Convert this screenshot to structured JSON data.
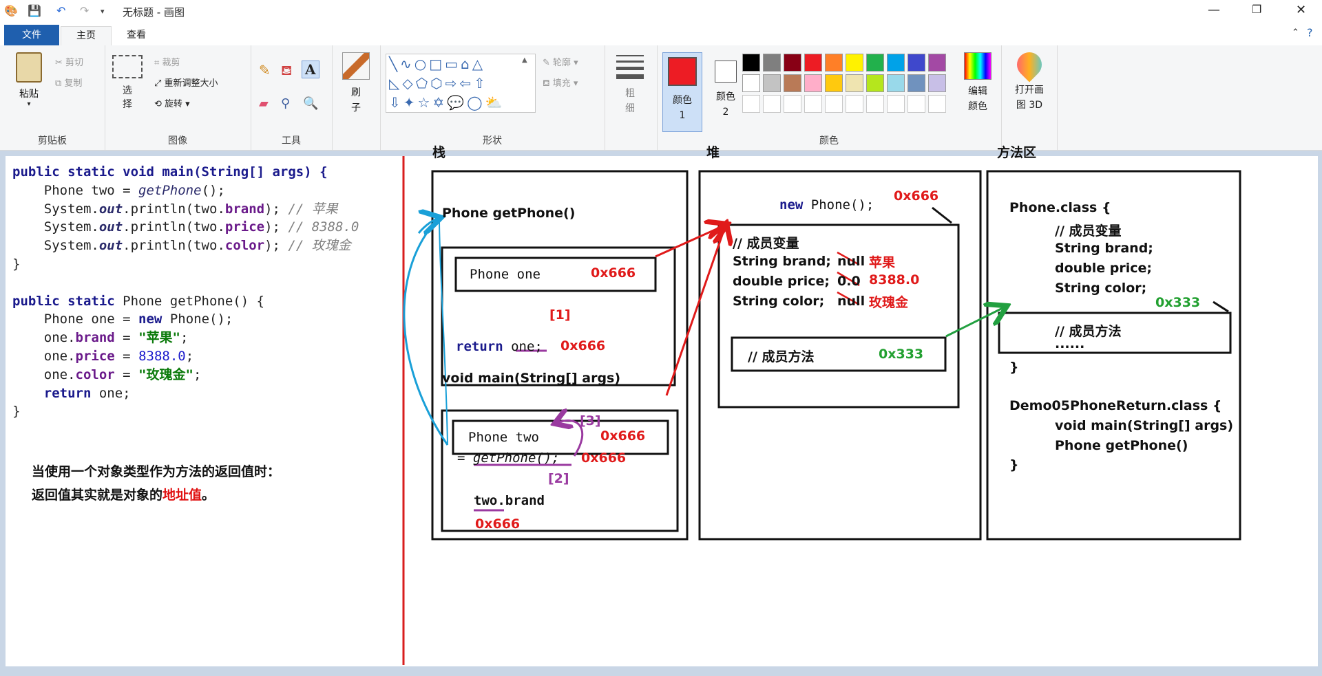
{
  "window": {
    "title": "无标题 - 画图",
    "tabs": [
      "文件",
      "主页",
      "查看"
    ]
  },
  "ribbon": {
    "clipboard": {
      "group": "剪贴板",
      "paste": "粘贴",
      "cut": "剪切",
      "copy": "复制"
    },
    "image": {
      "group": "图像",
      "select": "选择",
      "crop": "裁剪",
      "resize": "重新调整大小",
      "rotate": "旋转"
    },
    "tools": {
      "group": "工具"
    },
    "brush": {
      "label": "刷子"
    },
    "shapes": {
      "group": "形状",
      "outline": "轮廓",
      "fill": "填充"
    },
    "size": {
      "label": "粗细"
    },
    "colors": {
      "group": "颜色",
      "color1": "颜色 1",
      "color2": "颜色 2",
      "color1_value": "#ed1c24",
      "color2_value": "#ffffff",
      "edit": "编辑颜色",
      "paint3d": "打开画图 3D",
      "palette_row1": [
        "#000000",
        "#7f7f7f",
        "#880015",
        "#ed1c24",
        "#ff7f27",
        "#fff200",
        "#22b14c",
        "#00a2e8",
        "#3f48cc",
        "#a349a4"
      ],
      "palette_row2": [
        "#ffffff",
        "#c3c3c3",
        "#b97a57",
        "#ffaec9",
        "#ffc90e",
        "#efe4b0",
        "#b5e61d",
        "#99d9ea",
        "#7092be",
        "#c8bfe7"
      ]
    }
  },
  "code": {
    "l1": [
      "public static void main(String[] args) {"
    ],
    "l2a": "Phone two = ",
    "l2b": "getPhone",
    "l2c": "();",
    "l3a": "System.",
    "l3b": "out",
    "l3c": ".println(two.",
    "l3d": "brand",
    "l3e": "); ",
    "l3f": "// 苹果",
    "l4a": "System.",
    "l4b": "out",
    "l4c": ".println(two.",
    "l4d": "price",
    "l4e": "); ",
    "l4f": "// 8388.0",
    "l5a": "System.",
    "l5b": "out",
    "l5c": ".println(two.",
    "l5d": "color",
    "l5e": "); ",
    "l5f": "// 玫瑰金",
    "close": "}",
    "l7a": "public static",
    "l7b": " Phone getPhone() {",
    "l8a": "Phone one = ",
    "l8b": "new",
    "l8c": " Phone();",
    "l9a": "one.",
    "l9b": "brand",
    "l9c": " = ",
    "l9d": "\"苹果\"",
    "l9e": ";",
    "l10a": "one.",
    "l10b": "price",
    "l10c": " = ",
    "l10d": "8388.0",
    "l10e": ";",
    "l11a": "one.",
    "l11b": "color",
    "l11c": " = ",
    "l11d": "\"玫瑰金\"",
    "l11e": ";",
    "l12a": "return",
    "l12b": " one;"
  },
  "note": {
    "line1": "当使用一个对象类型作为方法的返回值时：",
    "line2a": "返回值其实就是对象的",
    "line2b": "地址值",
    "line2c": "。"
  },
  "stack": {
    "title": "栈",
    "getphone_label": "Phone getPhone()",
    "phone_one": "Phone one",
    "addr_one": "0x666",
    "step1": "[1]",
    "return_kw": "return",
    "return_var": "one;",
    "return_addr": "0x666",
    "main_label": "void main(String[] args)",
    "phone_two": "Phone two",
    "step3": "[3]",
    "addr_two": "0x666",
    "assign": "= getPhone();",
    "assign_addr": "0x666",
    "step2": "[2]",
    "two_brand": "two.brand",
    "brand_addr": "0x666"
  },
  "heap": {
    "title": "堆",
    "new_phone_kw": "new",
    "new_phone_rest": "Phone();",
    "addr": "0x666",
    "vars_title": "// 成员变量",
    "brand": "String brand;",
    "brand_old": "null",
    "brand_new": "苹果",
    "price": "double price;",
    "price_old": "0.0",
    "price_new": "8388.0",
    "color": "String color;",
    "color_old": "null",
    "color_new": "玫瑰金",
    "methods": "// 成员方法",
    "methods_addr": "0x333"
  },
  "method_area": {
    "title": "方法区",
    "phone_class": "Phone.class {",
    "vars_title": "// 成员变量",
    "brand": "String brand;",
    "price": "double price;",
    "color": "String color;",
    "methods_addr": "0x333",
    "methods": "// 成员方法",
    "ellipsis": "......",
    "close1": "}",
    "demo_class": "Demo05PhoneReturn.class {",
    "main": "void main(String[] args)",
    "getphone": "Phone getPhone()",
    "close2": "}"
  }
}
